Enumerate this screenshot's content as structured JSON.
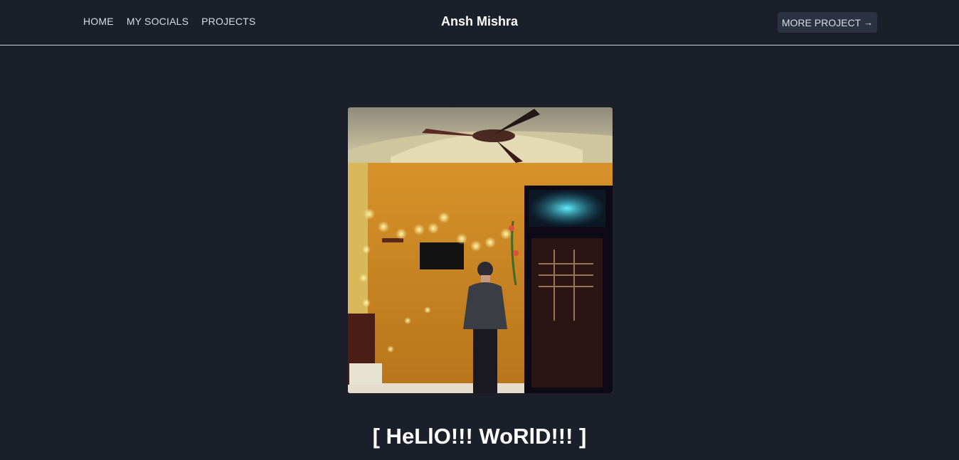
{
  "nav": {
    "links": [
      "HOME",
      "MY SOCIALS",
      "PROJECTS"
    ],
    "brand": "Ansh Mishra",
    "cta_label": "MORE PROJECT",
    "cta_icon": "arrow-right-icon"
  },
  "hero": {
    "image_subject": "person standing in a room with string lights, ceiling fan and doorway",
    "headline": "[ HeLlO!!! WoRlD!!! ]"
  },
  "colors": {
    "background": "#1b1f29",
    "button_bg": "#2b3241",
    "wall": "#c8851f",
    "divider": "#c9ccd3"
  }
}
